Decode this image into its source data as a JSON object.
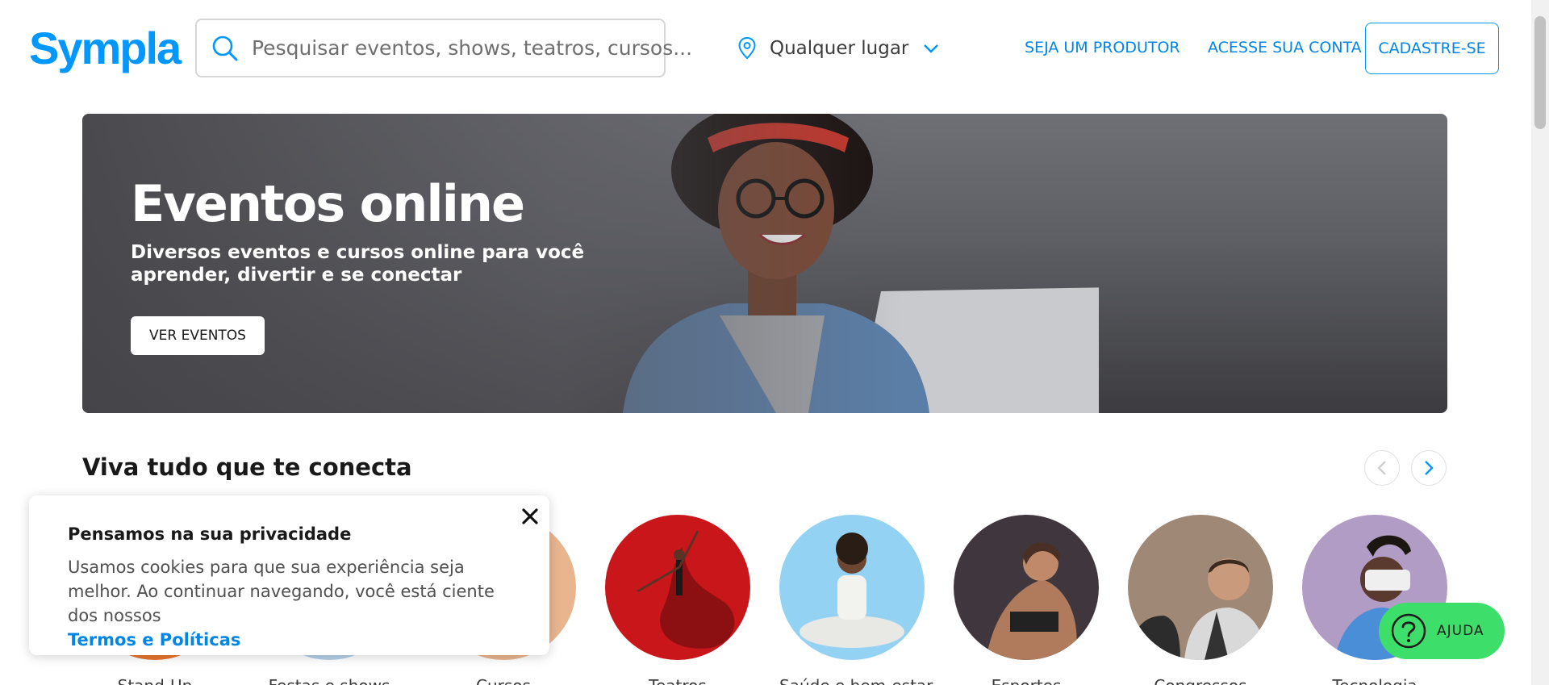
{
  "header": {
    "logo_text": "Sympla",
    "search_placeholder": "Pesquisar eventos, shows, teatros, cursos...",
    "location_label": "Qualquer lugar",
    "nav": {
      "producer": "SEJA UM PRODUTOR",
      "login": "ACESSE SUA CONTA",
      "signup": "CADASTRE-SE"
    }
  },
  "hero": {
    "title": "Eventos online",
    "subtitle": "Diversos eventos e cursos online para você aprender, divertir e se conectar",
    "button": "VER EVENTOS"
  },
  "section": {
    "title": "Viva tudo que te conecta",
    "categories": [
      {
        "label": "Stand-Up"
      },
      {
        "label": "Festas e shows"
      },
      {
        "label": "Cursos"
      },
      {
        "label": "Teatros"
      },
      {
        "label": "Saúde e bem-estar"
      },
      {
        "label": "Esportes"
      },
      {
        "label": "Congressos"
      },
      {
        "label": "Tecnologia"
      }
    ]
  },
  "cookie": {
    "title": "Pensamos na sua privacidade",
    "text": "Usamos cookies para que sua experiência seja melhor. Ao continuar navegando, você está ciente dos nossos",
    "link": "Termos e Políticas"
  },
  "help": {
    "label": "AJUDA"
  },
  "colors": {
    "brand": "#0097ff",
    "help_green": "#3ddf6a"
  }
}
